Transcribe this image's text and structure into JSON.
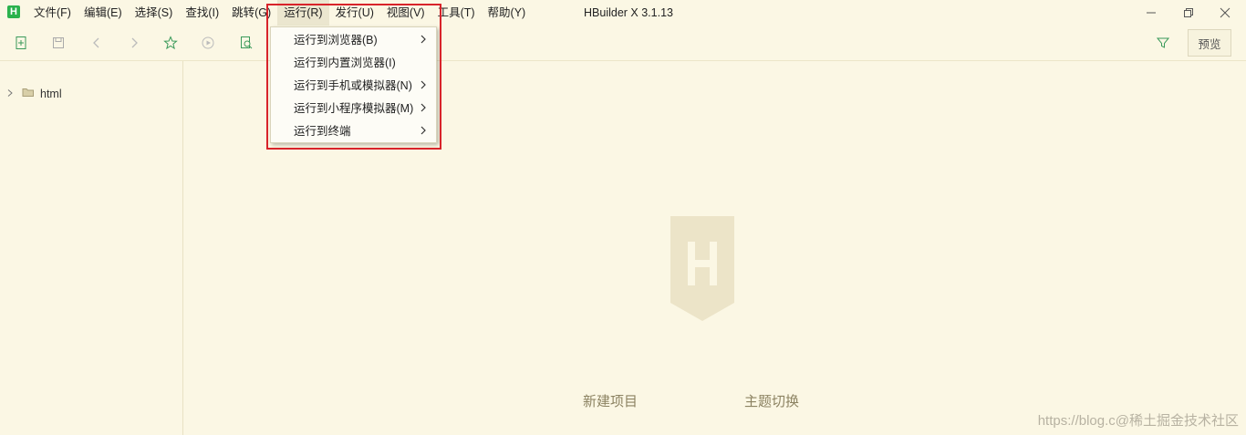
{
  "app": {
    "logo_letter": "H",
    "title": "HBuilder X 3.1.13"
  },
  "menu": [
    {
      "label": "文件(F)"
    },
    {
      "label": "编辑(E)"
    },
    {
      "label": "选择(S)"
    },
    {
      "label": "查找(I)"
    },
    {
      "label": "跳转(G)"
    },
    {
      "label": "运行(R)",
      "active": true
    },
    {
      "label": "发行(U)"
    },
    {
      "label": "视图(V)"
    },
    {
      "label": "工具(T)"
    },
    {
      "label": "帮助(Y)"
    }
  ],
  "run_menu": {
    "items": [
      {
        "label": "运行到浏览器(B)",
        "has_submenu": true
      },
      {
        "label": "运行到内置浏览器(I)",
        "has_submenu": false
      },
      {
        "label": "运行到手机或模拟器(N)",
        "has_submenu": true
      },
      {
        "label": "运行到小程序模拟器(M)",
        "has_submenu": true
      },
      {
        "label": "运行到终端",
        "has_submenu": true
      }
    ]
  },
  "toolbar": {
    "icons": [
      "new-file-icon",
      "save-icon",
      "back-icon",
      "forward-icon",
      "star-icon",
      "run-icon",
      "browser-preview-icon",
      "filter-icon"
    ],
    "preview_label": "预览"
  },
  "sidebar": {
    "tree": [
      {
        "label": "html",
        "type": "folder",
        "expanded": false
      }
    ]
  },
  "welcome": {
    "new_project": "新建项目",
    "theme_switch": "主题切换"
  },
  "watermark": "https://blog.c@稀土掘金技术社区",
  "colors": {
    "background": "#fbf7e4",
    "accent_green": "#2bb24c",
    "highlight_red": "#d8232a",
    "logo_shield": "#ece4c8"
  }
}
